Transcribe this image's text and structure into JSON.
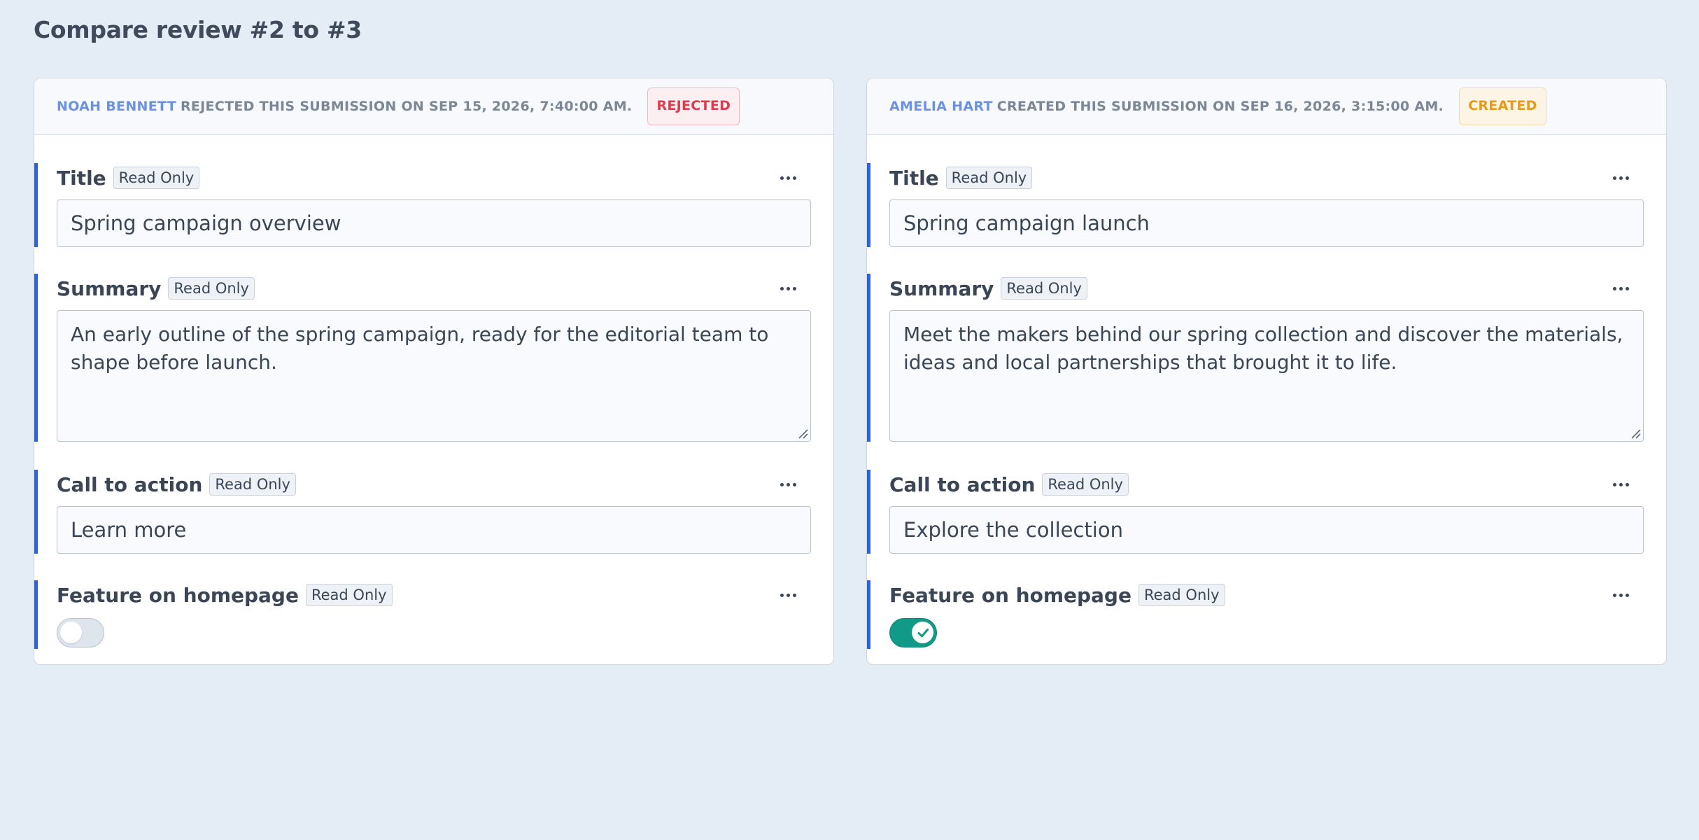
{
  "page": {
    "title": "Compare review #2 to #3"
  },
  "left": {
    "author": "NOAH BENNETT",
    "action_text": "REJECTED THIS SUBMISSION ON SEP 15, 2026, 7:40:00 AM.",
    "status": "REJECTED",
    "status_color": "#e03a4e",
    "fields": {
      "title": {
        "label": "Title",
        "badge": "Read Only",
        "value": "Spring campaign overview"
      },
      "summary": {
        "label": "Summary",
        "badge": "Read Only",
        "value": "An early outline of the spring campaign, ready for the editorial team to shape before launch."
      },
      "cta": {
        "label": "Call to action",
        "badge": "Read Only",
        "value": "Learn more"
      },
      "feature": {
        "label": "Feature on homepage",
        "badge": "Read Only",
        "checked": false
      }
    }
  },
  "right": {
    "author": "AMELIA HART",
    "action_text": "CREATED THIS SUBMISSION ON SEP 16, 2026, 3:15:00 AM.",
    "status": "CREATED",
    "status_color": "#e99a16",
    "fields": {
      "title": {
        "label": "Title",
        "badge": "Read Only",
        "value": "Spring campaign launch"
      },
      "summary": {
        "label": "Summary",
        "badge": "Read Only",
        "value": "Meet the makers behind our spring collection and discover the materials, ideas and local partnerships that brought it to life."
      },
      "cta": {
        "label": "Call to action",
        "badge": "Read Only",
        "value": "Explore the collection"
      },
      "feature": {
        "label": "Feature on homepage",
        "badge": "Read Only",
        "checked": true
      }
    }
  },
  "colors": {
    "background": "#e4ecf5",
    "accent_bar": "#2563eb",
    "author_link": "#6b92e0",
    "toggle_on": "#109a87"
  },
  "icons": {
    "field_menu": "more-horizontal-icon",
    "resize": "resize-handle-icon",
    "check": "check-icon"
  }
}
